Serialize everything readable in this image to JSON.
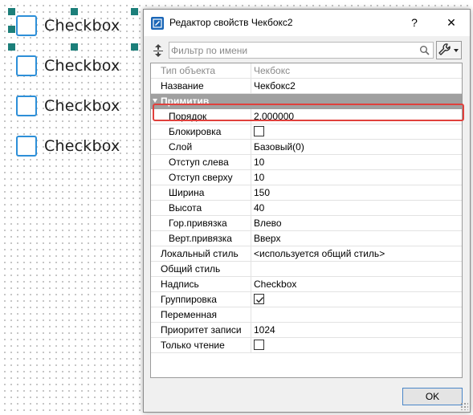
{
  "canvas": {
    "checkboxes": [
      {
        "label": "Checkbox"
      },
      {
        "label": "Checkbox"
      },
      {
        "label": "Checkbox"
      },
      {
        "label": "Checkbox"
      }
    ]
  },
  "dialog": {
    "title": "Редактор свойств Чекбокс2",
    "help_label": "?",
    "close_label": "✕",
    "filter_placeholder": "Фильтр по имени",
    "ok_label": "OK",
    "accent": "#1a66b7",
    "highlight_color": "#e0403c",
    "category_color": "#a0a0a0"
  },
  "properties": {
    "object_type": {
      "name": "Тип объекта",
      "value": "Чекбокс"
    },
    "name": {
      "name": "Название",
      "value": "Чекбокс2"
    },
    "category_primitive": "Примитив",
    "order": {
      "name": "Порядок",
      "value": "2,000000"
    },
    "lock": {
      "name": "Блокировка",
      "checked": false
    },
    "layer": {
      "name": "Слой",
      "value": "Базовый(0)"
    },
    "left": {
      "name": "Отступ слева",
      "value": "10"
    },
    "top": {
      "name": "Отступ сверху",
      "value": "10"
    },
    "width": {
      "name": "Ширина",
      "value": "150"
    },
    "height": {
      "name": "Высота",
      "value": "40"
    },
    "hanchor": {
      "name": "Гор.привязка",
      "value": "Влево"
    },
    "vanchor": {
      "name": "Верт.привязка",
      "value": "Вверх"
    },
    "local_style": {
      "name": "Локальный стиль",
      "value": "<используется общий стиль>"
    },
    "common_style": {
      "name": "Общий стиль",
      "value": ""
    },
    "caption": {
      "name": "Надпись",
      "value": "Checkbox"
    },
    "grouping": {
      "name": "Группировка",
      "checked": true
    },
    "variable": {
      "name": "Переменная",
      "value": ""
    },
    "priority": {
      "name": "Приоритет записи",
      "value": "1024"
    },
    "readonly": {
      "name": "Только чтение",
      "checked": false
    }
  }
}
